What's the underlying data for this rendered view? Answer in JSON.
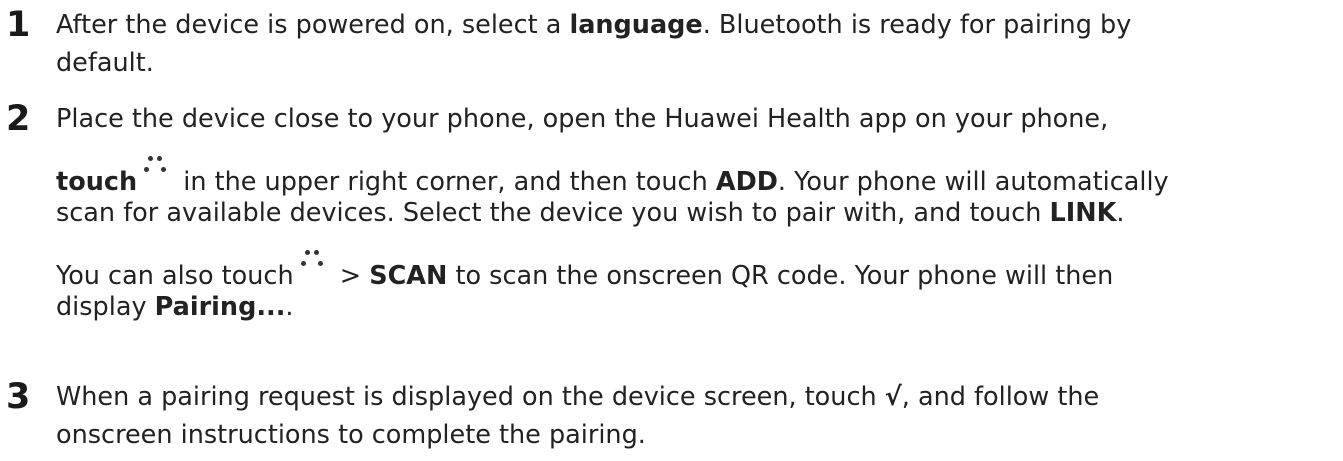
{
  "steps": [
    {
      "number": "1",
      "lines": [
        [
          "After the device is powered on, select a ",
          "language",
          ". Bluetooth is ready for pairing by"
        ],
        [
          "default."
        ]
      ]
    },
    {
      "number": "2",
      "line1": "Place the device close to your phone, open the Huawei Health app on your phone,",
      "line2_bold": "touch",
      "line2_rest": " in the upper right corner, and then touch ",
      "line2_add": "ADD",
      "line2_end": ". Your phone will automatically",
      "line3_start": "scan for available devices. Select the device you wish to pair with, and touch ",
      "line3_link": "LINK",
      "line3_end": ".",
      "line4_start": "You can also touch",
      "line4_gt": " > ",
      "line4_scan": "SCAN",
      "line4_end": " to scan the onscreen QR code. Your phone will then",
      "line5_start": "display ",
      "line5_pairing": "Pairing...",
      "line5_end": "."
    },
    {
      "number": "3",
      "line1_start": "When a pairing request is displayed on the device screen, touch ",
      "line1_check": "√",
      "line1_end": ", and follow the",
      "line2": "onscreen instructions to complete the pairing."
    }
  ],
  "icons": {
    "more": "more-dots-icon"
  },
  "colors": {
    "text": "#222222",
    "number": "#1a1a1a",
    "background": "#ffffff"
  }
}
